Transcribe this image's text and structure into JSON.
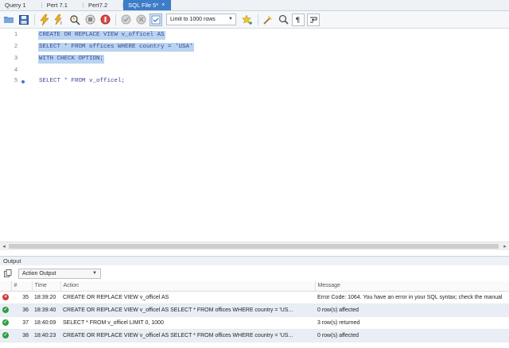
{
  "tabs": [
    {
      "label": "Query 1",
      "active": false
    },
    {
      "label": "Pert 7.1",
      "active": false
    },
    {
      "label": "Pert7.2",
      "active": false
    },
    {
      "label": "SQL File 5*",
      "active": true
    }
  ],
  "tab_close_glyph": "×",
  "toolbar": {
    "limit_label": "Limit to 1000 rows",
    "icons": [
      "open-folder-icon",
      "save-icon",
      "execute-icon",
      "execute-current-icon",
      "explain-icon",
      "stop-icon",
      "toggle-continue-icon",
      "commit-icon",
      "rollback-icon",
      "autocommit-icon",
      "add-snippet-icon",
      "beautify-icon",
      "find-icon",
      "invisible-chars-icon",
      "word-wrap-icon"
    ]
  },
  "editor": {
    "lines": [
      {
        "num": "1",
        "code": "CREATE OR REPLACE VIEW v_officel AS",
        "selected": true,
        "marker": false
      },
      {
        "num": "2",
        "code": "SELECT * FROM offices WHERE country = 'USA'",
        "selected": true,
        "marker": false
      },
      {
        "num": "3",
        "code": "WITH CHECK OPTION;",
        "selected": true,
        "marker": false
      },
      {
        "num": "4",
        "code": "",
        "selected": false,
        "marker": false
      },
      {
        "num": "5",
        "code": "SELECT * FROM v_officel;",
        "selected": false,
        "marker": true
      }
    ]
  },
  "output": {
    "header": "Output",
    "select_label": "Action Output",
    "columns": [
      "#",
      "Time",
      "Action",
      "Message"
    ],
    "rows": [
      {
        "status": "error",
        "num": "35",
        "time": "18:39:20",
        "action": "CREATE OR REPLACE VIEW v_officel AS",
        "message": "Error Code: 1064. You have an error in your SQL syntax; check the manual"
      },
      {
        "status": "ok",
        "num": "36",
        "time": "18:39:40",
        "action": "CREATE OR REPLACE VIEW v_officel AS SELECT * FROM offices WHERE country = 'US...",
        "message": "0 row(s) affected"
      },
      {
        "status": "ok",
        "num": "37",
        "time": "18:40:09",
        "action": "SELECT * FROM v_officel LIMIT 0, 1000",
        "message": "3 row(s) returned"
      },
      {
        "status": "ok",
        "num": "38",
        "time": "18:40:23",
        "action": "CREATE OR REPLACE VIEW v_officel AS SELECT * FROM offices WHERE country = 'US...",
        "message": "0 row(s) affected"
      }
    ]
  },
  "colors": {
    "accent": "#3d7cc9",
    "selection": "#b9d3f0",
    "error": "#d23a3a",
    "ok": "#2e9e3e"
  }
}
